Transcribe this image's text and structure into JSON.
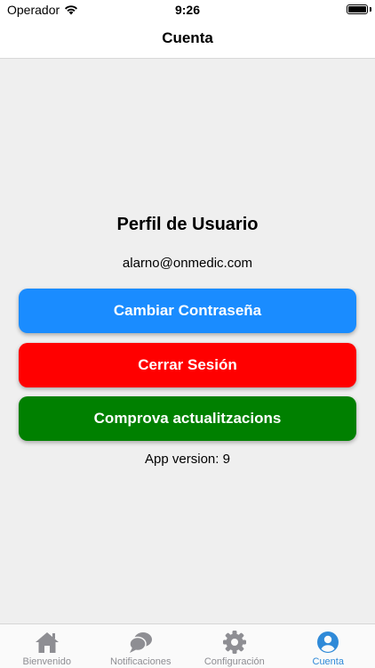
{
  "status_bar": {
    "carrier": "Operador",
    "time": "9:26"
  },
  "nav": {
    "title": "Cuenta"
  },
  "profile": {
    "title": "Perfil de Usuario",
    "email": "alarno@onmedic.com",
    "version_text": "App version: 9"
  },
  "buttons": {
    "change_password": "Cambiar Contraseña",
    "logout": "Cerrar Sesión",
    "check_updates": "Comprova actualitzacions"
  },
  "tabs": [
    {
      "label": "Bienvenido",
      "icon": "home-icon"
    },
    {
      "label": "Notificaciones",
      "icon": "chat-bubbles-icon"
    },
    {
      "label": "Configuración",
      "icon": "gear-icon"
    },
    {
      "label": "Cuenta",
      "icon": "user-circle-icon",
      "active": true
    }
  ],
  "colors": {
    "change_password": "#1a8cff",
    "logout": "#ff0000",
    "check_updates": "#008000",
    "tab_active": "#2f8ad8",
    "tab_inactive": "#8e8e93"
  }
}
